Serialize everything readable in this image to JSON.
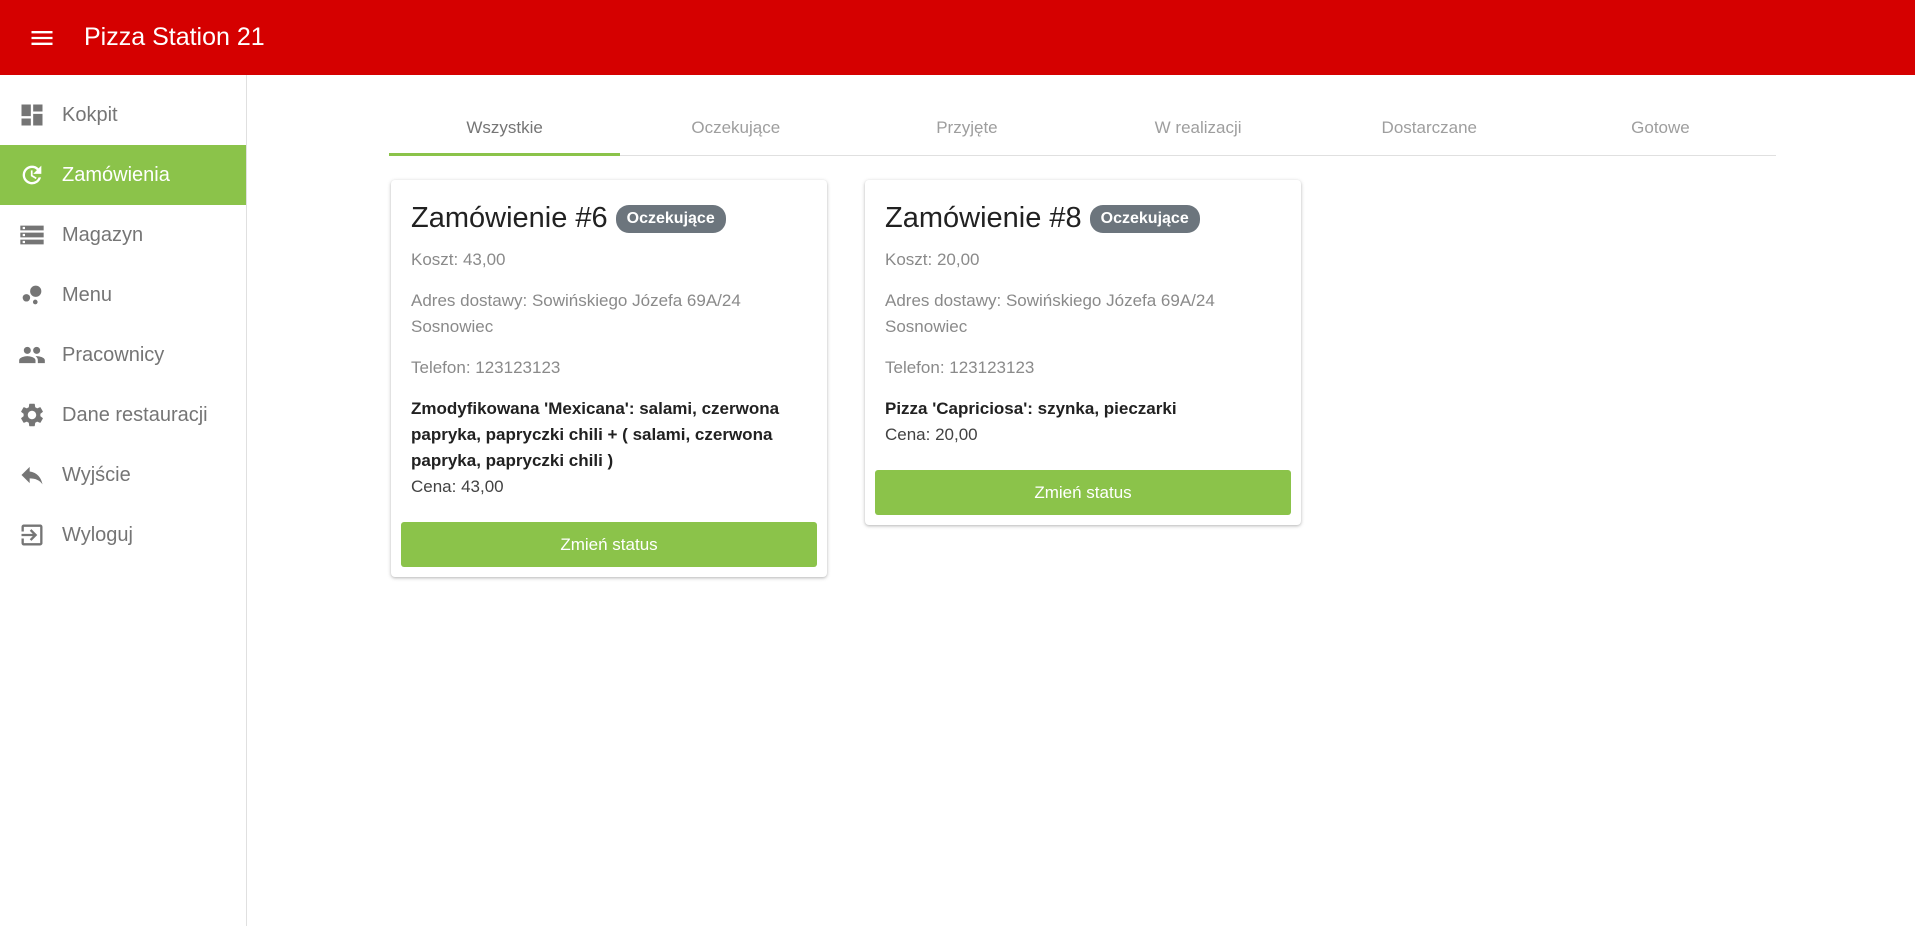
{
  "app": {
    "title": "Pizza Station 21"
  },
  "sidebar": {
    "items": [
      {
        "label": "Kokpit"
      },
      {
        "label": "Zamówienia"
      },
      {
        "label": "Magazyn"
      },
      {
        "label": "Menu"
      },
      {
        "label": "Pracownicy"
      },
      {
        "label": "Dane restauracji"
      },
      {
        "label": "Wyjście"
      },
      {
        "label": "Wyloguj"
      }
    ],
    "active_index": 1
  },
  "tabs": [
    {
      "label": "Wszystkie"
    },
    {
      "label": "Oczekujące"
    },
    {
      "label": "Przyjęte"
    },
    {
      "label": "W realizacji"
    },
    {
      "label": "Dostarczane"
    },
    {
      "label": "Gotowe"
    }
  ],
  "orders": [
    {
      "title": "Zamówienie #6",
      "status": "Oczekujące",
      "cost": "Koszt: 43,00",
      "address": "Adres dostawy: Sowińskiego Józefa 69A/24 Sosnowiec",
      "phone": "Telefon: 123123123",
      "item": "Zmodyfikowana 'Mexicana': salami, czerwona papryka, papryczki chili + ( salami, czerwona papryka, papryczki chili )",
      "price": "Cena: 43,00",
      "button": "Zmień status"
    },
    {
      "title": "Zamówienie #8",
      "status": "Oczekujące",
      "cost": "Koszt: 20,00",
      "address": "Adres dostawy: Sowińskiego Józefa 69A/24 Sosnowiec",
      "phone": "Telefon: 123123123",
      "item": "Pizza 'Capriciosa': szynka, pieczarki",
      "price": "Cena: 20,00",
      "button": "Zmień status"
    }
  ],
  "colors": {
    "topbar": "#d50000",
    "accent": "#8bc34a",
    "badge": "#6c757d"
  }
}
